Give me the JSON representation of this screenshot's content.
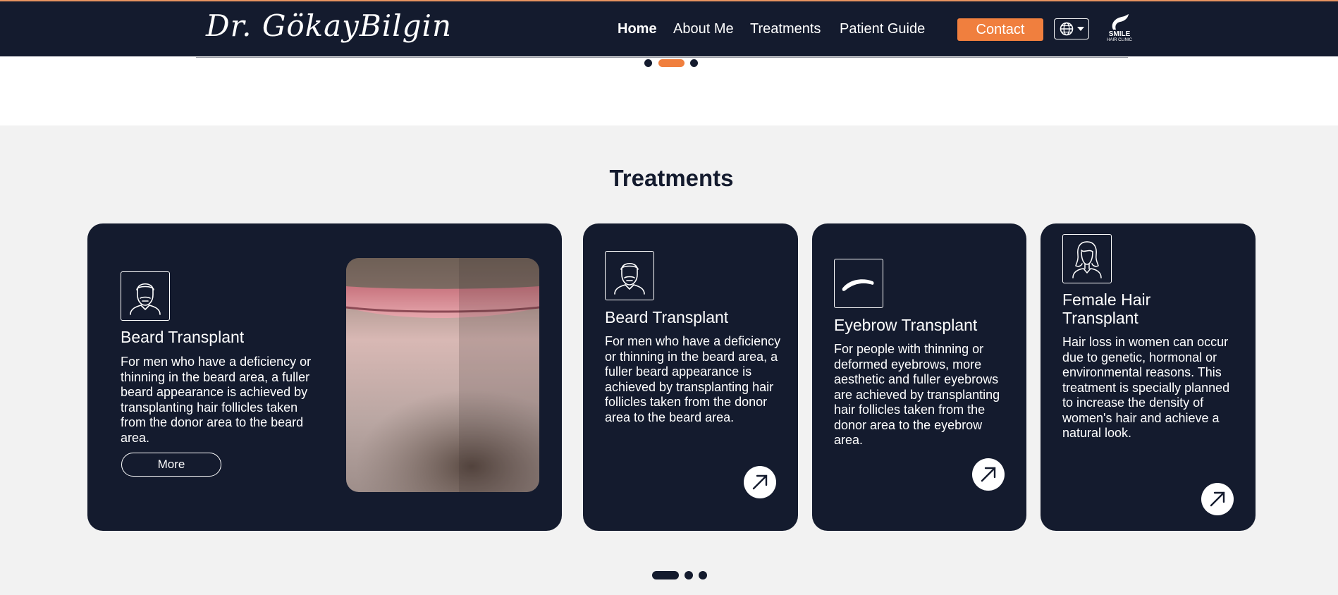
{
  "header": {
    "logo_text": "Dr. GökayBilgin",
    "nav": [
      "Home",
      "About Me",
      "Treatments",
      "Patient Guide"
    ],
    "contact_label": "Contact",
    "clinic_logo_line1": "SMILE",
    "clinic_logo_line2": "HAIR CLINIC"
  },
  "hero_carousel": {
    "dots": 3,
    "active_index": 1
  },
  "treatments": {
    "title": "Treatments",
    "featured": {
      "title": "Beard Transplant",
      "description": "For men who have a deficiency or thinning in the beard area, a fuller beard appearance is achieved by transplanting hair follicles taken from the donor area to the beard area.",
      "button_label": "More"
    },
    "cards": [
      {
        "title": "Beard Transplant",
        "description": "For men who have a deficiency or thinning in the beard area, a fuller beard appearance is achieved by transplanting hair follicles taken from the donor area to the beard area.",
        "icon": "beard-icon"
      },
      {
        "title": "Eyebrow Transplant",
        "description": "For people with thinning or deformed eyebrows, more aesthetic and fuller eyebrows are achieved by transplanting hair follicles taken from the donor area to the eyebrow area.",
        "icon": "eyebrow-icon"
      },
      {
        "title": "Female Hair Transplant",
        "description": "Hair loss in women can occur due to genetic, hormonal or environmental reasons. This treatment is specially planned to increase the density of women's hair and achieve a natural look.",
        "icon": "female-icon"
      }
    ],
    "carousel": {
      "dots": 3,
      "active_index": 0
    }
  },
  "colors": {
    "navy": "#141b2e",
    "accent": "#f07f3e",
    "section_bg": "#f2f2f2"
  }
}
